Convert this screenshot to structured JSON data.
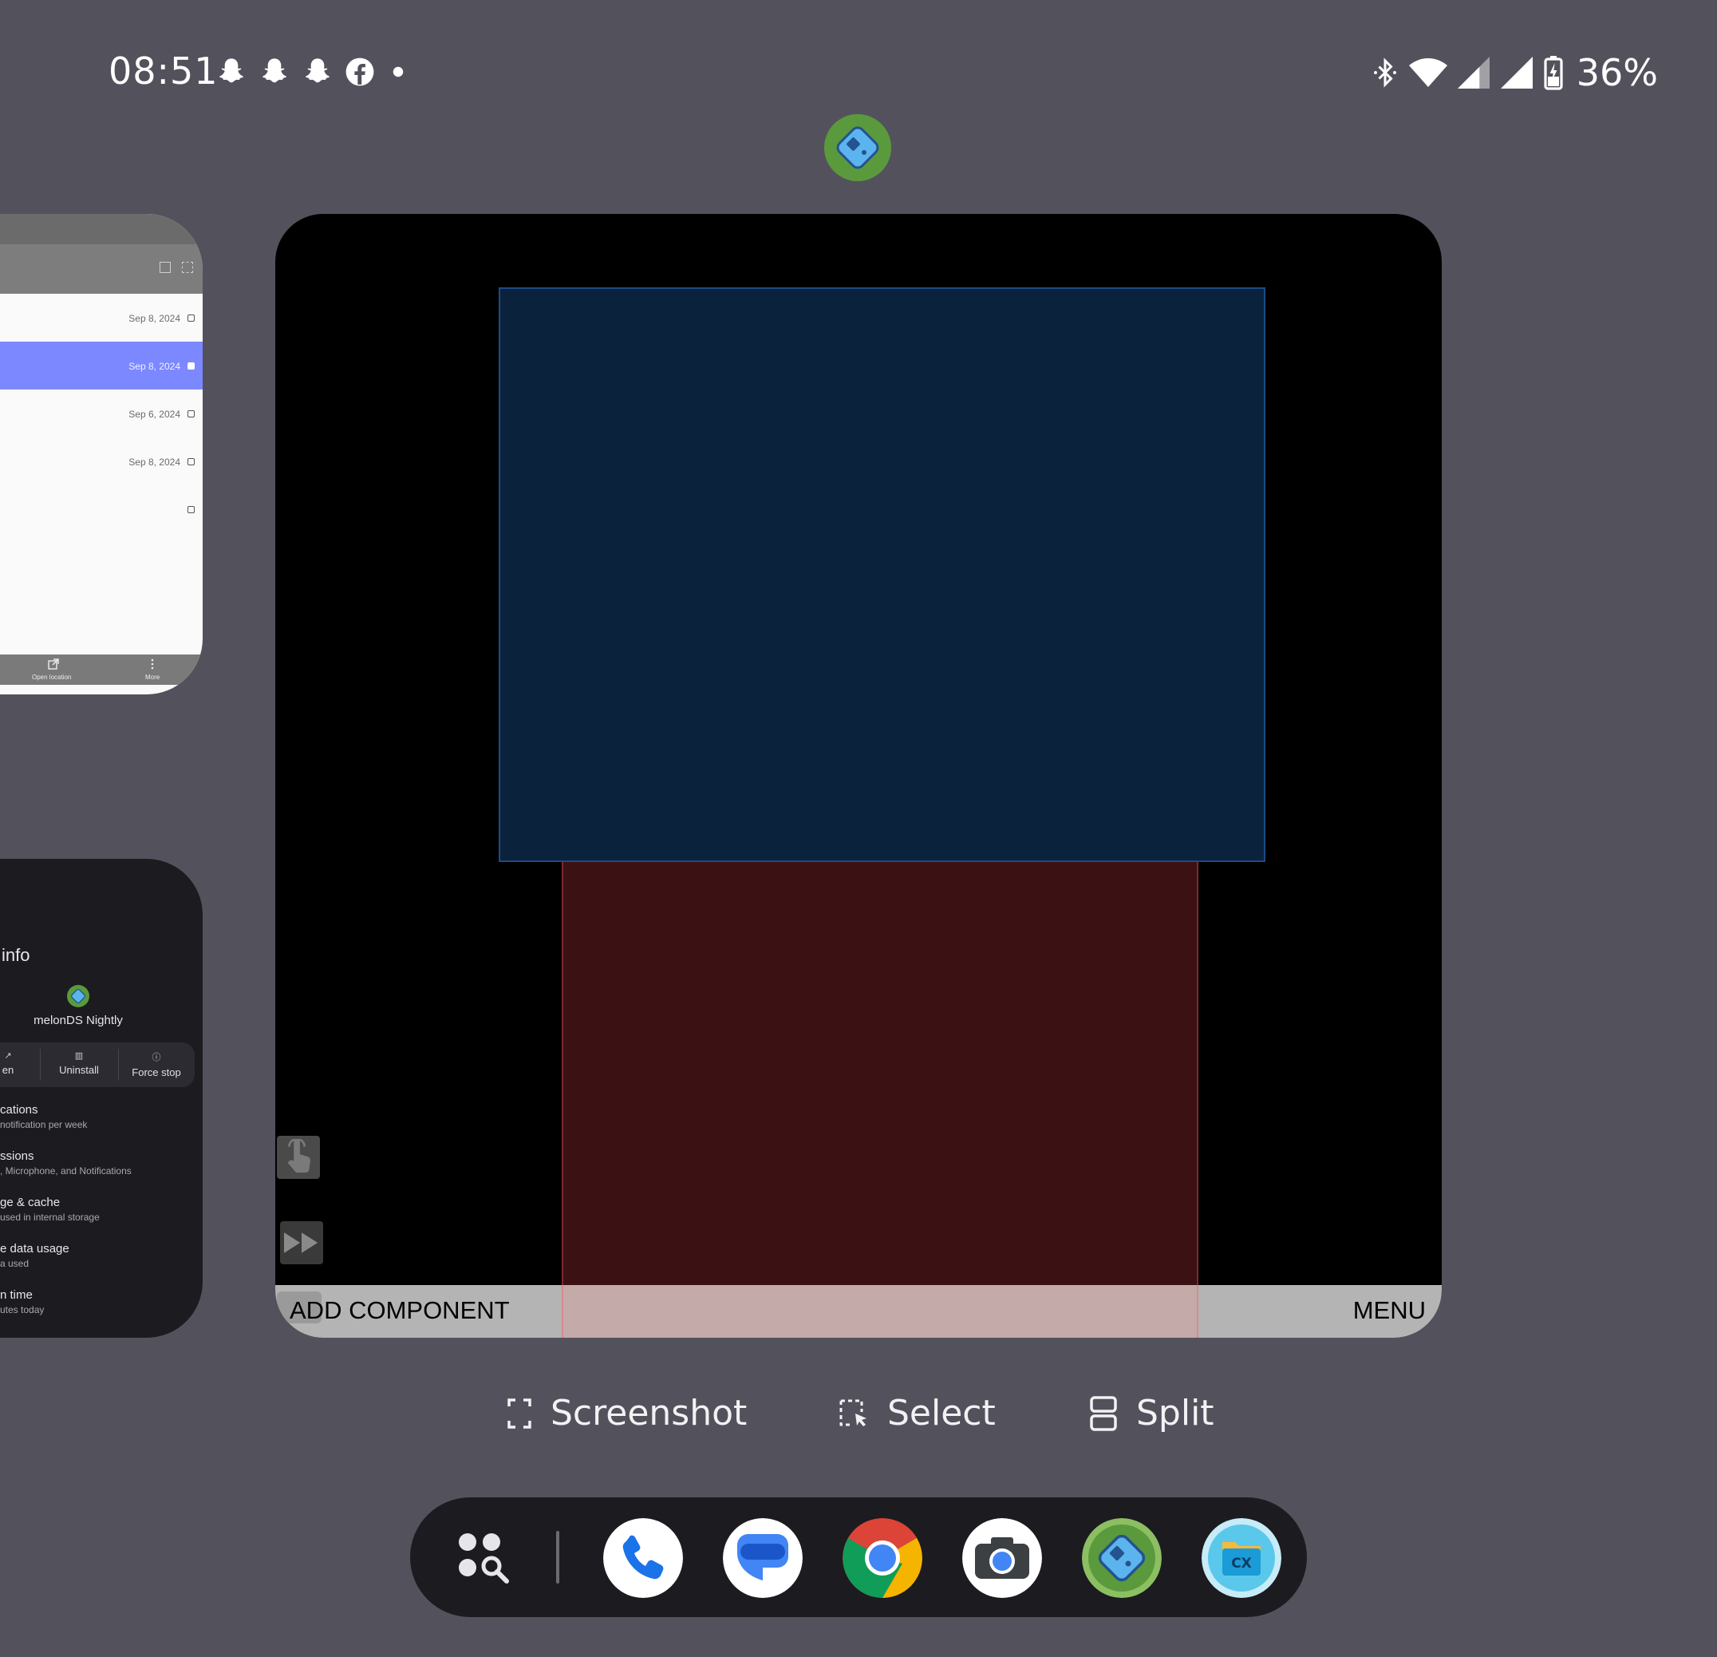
{
  "status_bar": {
    "time": "08:51",
    "notification_icons": [
      "snapchat-icon",
      "snapchat-icon",
      "snapchat-icon",
      "facebook-icon",
      "dot-icon"
    ],
    "system_icons": [
      "bluetooth-icon",
      "wifi-icon",
      "signal-icon",
      "signal-icon",
      "battery-charging-icon"
    ],
    "battery_percent": "36%"
  },
  "main_task": {
    "app_icon": "melonds-icon",
    "add_component_label": "ADD COMPONENT",
    "menu_label": "MENU",
    "colors": {
      "top_screen": "#0b223d",
      "bottom_screen": "#3c1114"
    }
  },
  "side_task_files": {
    "rows": [
      {
        "date": "Sep 8, 2024",
        "selected": false
      },
      {
        "date": "Sep 8, 2024",
        "selected": true
      },
      {
        "date": "Sep 6, 2024",
        "selected": false
      },
      {
        "date": "Sep 8, 2024",
        "selected": false
      },
      {
        "date": "",
        "selected": false
      }
    ],
    "bottom_actions": [
      "Open location",
      "More"
    ]
  },
  "side_task_app_info": {
    "title": "info",
    "app_name": "melonDS Nightly",
    "actions": [
      {
        "label": "en",
        "icon": "open-icon"
      },
      {
        "label": "Uninstall",
        "icon": "trash-icon"
      },
      {
        "label": "Force stop",
        "icon": "stop-icon"
      }
    ],
    "items": [
      {
        "title": "cations",
        "subtitle": "notification per week"
      },
      {
        "title": "ssions",
        "subtitle": ", Microphone, and Notifications"
      },
      {
        "title": "ge & cache",
        "subtitle": "used in internal storage"
      },
      {
        "title": "e data usage",
        "subtitle": "a used"
      },
      {
        "title": "n time",
        "subtitle": "utes today"
      }
    ]
  },
  "actions": {
    "screenshot": "Screenshot",
    "select": "Select",
    "split": "Split"
  },
  "dock": {
    "apps": [
      "app-drawer-search-icon",
      "phone-icon",
      "messages-icon",
      "chrome-icon",
      "camera-icon",
      "melonds-icon",
      "cx-file-explorer-icon"
    ]
  }
}
